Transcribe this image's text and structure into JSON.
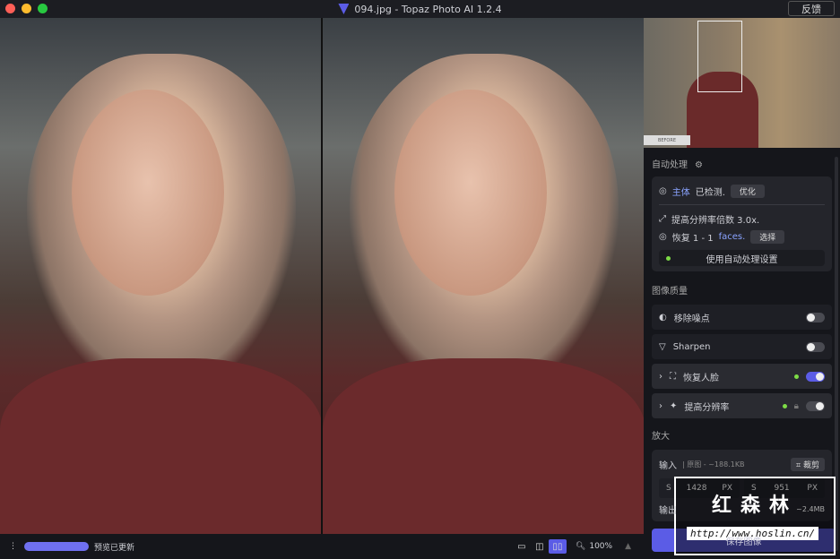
{
  "window": {
    "title": "094.jpg - Topaz Photo AI 1.2.4",
    "feedback": "反馈"
  },
  "thumbnail": {
    "before_label": "BEFORE"
  },
  "auto": {
    "title": "自动处理",
    "subject_word": "主体",
    "subject_rest": "已检测.",
    "optimize": "优化",
    "upscale": "提高分辨率倍数 3.0x.",
    "recover_prefix": "恢复 1 - 1",
    "recover_faces": "faces.",
    "select": "选择",
    "apply": "使用自动处理设置"
  },
  "quality": {
    "title": "图像质量",
    "tools": [
      {
        "label": "移除噪点",
        "enabled": false
      },
      {
        "label": "Sharpen",
        "enabled": false
      },
      {
        "label": "恢复人脸",
        "enabled": true
      },
      {
        "label": "提高分辨率",
        "enabled": true
      }
    ]
  },
  "enlarge": {
    "title": "放大",
    "input_label": "输入",
    "input_info": "| 原图 - ~188.1KB",
    "crop": "裁剪",
    "w_prefix": "S",
    "width": "1428",
    "h_prefix": "S",
    "height": "951",
    "unit": "PX",
    "output_label": "输出",
    "output_size": "~2.4MB",
    "save": "保存图像"
  },
  "watermark": {
    "cn": "红森林",
    "url": "http://www.hoslin.cn/"
  },
  "bottom": {
    "status": "预览已更新",
    "zoom": "100%",
    "progress": 1.0
  },
  "colors": {
    "accent": "#5b5ce6",
    "green": "#7ddc46"
  }
}
